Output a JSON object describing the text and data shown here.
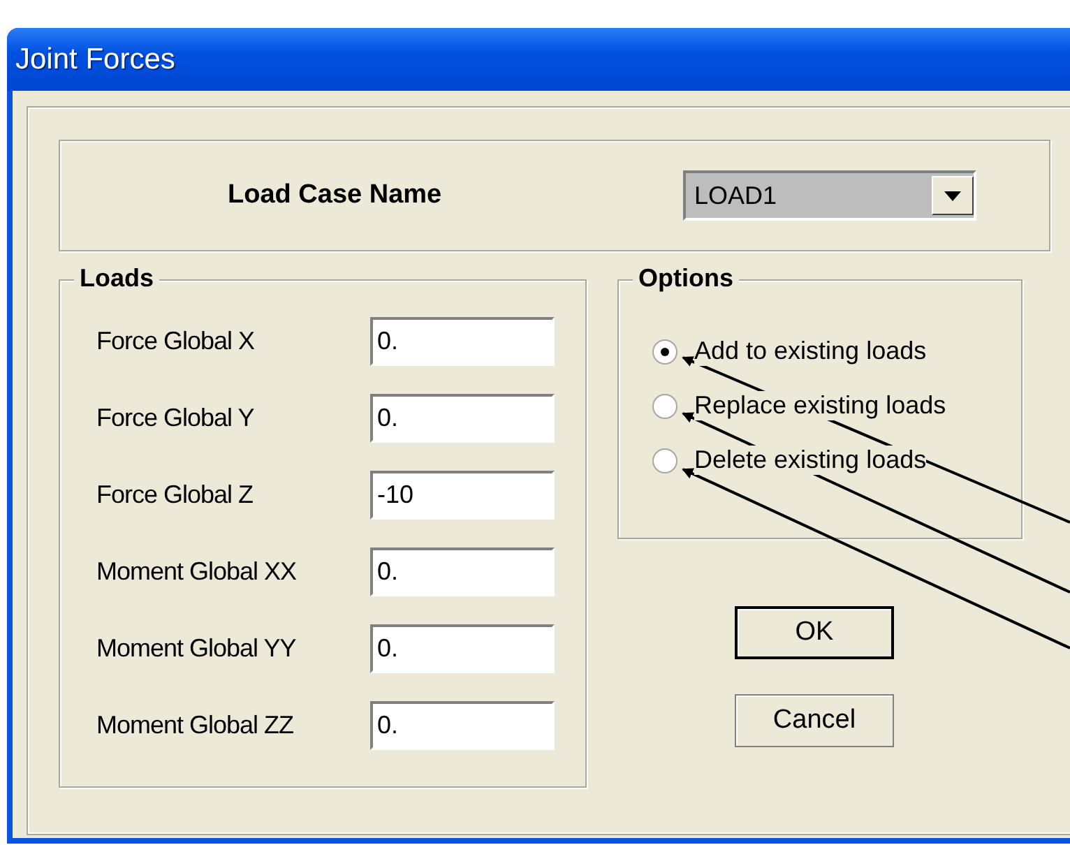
{
  "window": {
    "title": "Joint Forces"
  },
  "load_case": {
    "label": "Load Case Name",
    "value": "LOAD1"
  },
  "loads": {
    "title": "Loads",
    "fields": [
      {
        "label": "Force Global X",
        "value": "0."
      },
      {
        "label": "Force Global Y",
        "value": "0."
      },
      {
        "label": "Force Global Z",
        "value": "-10"
      },
      {
        "label": "Moment Global XX",
        "value": "0."
      },
      {
        "label": "Moment Global YY",
        "value": "0."
      },
      {
        "label": "Moment Global ZZ",
        "value": "0."
      }
    ]
  },
  "options": {
    "title": "Options",
    "items": [
      {
        "label": "Add to existing loads",
        "selected": true
      },
      {
        "label": "Replace existing loads",
        "selected": false
      },
      {
        "label": "Delete existing loads",
        "selected": false
      }
    ]
  },
  "buttons": [
    {
      "label": "OK",
      "default": true
    },
    {
      "label": "Cancel",
      "default": false
    }
  ]
}
